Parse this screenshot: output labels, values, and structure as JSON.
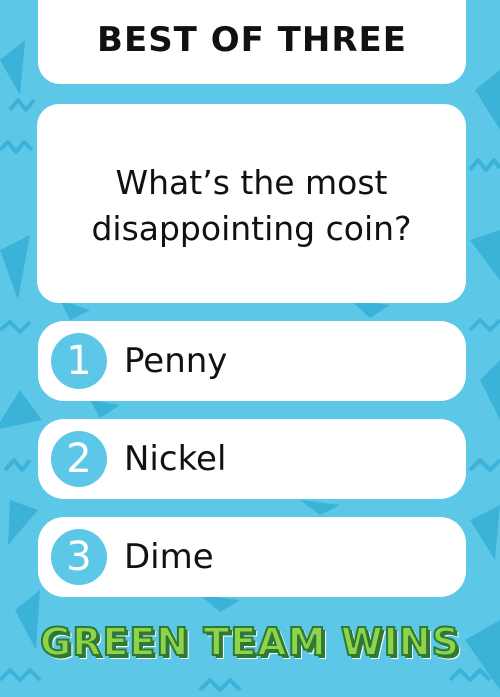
{
  "header": {
    "title": "BEST OF THREE"
  },
  "question": {
    "text": "What’s the most disappointing coin?"
  },
  "answers": [
    {
      "number": "1",
      "label": "Penny"
    },
    {
      "number": "2",
      "label": "Nickel"
    },
    {
      "number": "3",
      "label": "Dime"
    }
  ],
  "team_banner": {
    "text": "GREEN TEAM WINS"
  },
  "colors": {
    "background": "#5cc7e6",
    "pattern": "#3bb3d9",
    "card": "#ffffff",
    "number_circle": "#5cc7e6",
    "team_green": "#8ed34a",
    "team_outline": "#2e7a34"
  }
}
